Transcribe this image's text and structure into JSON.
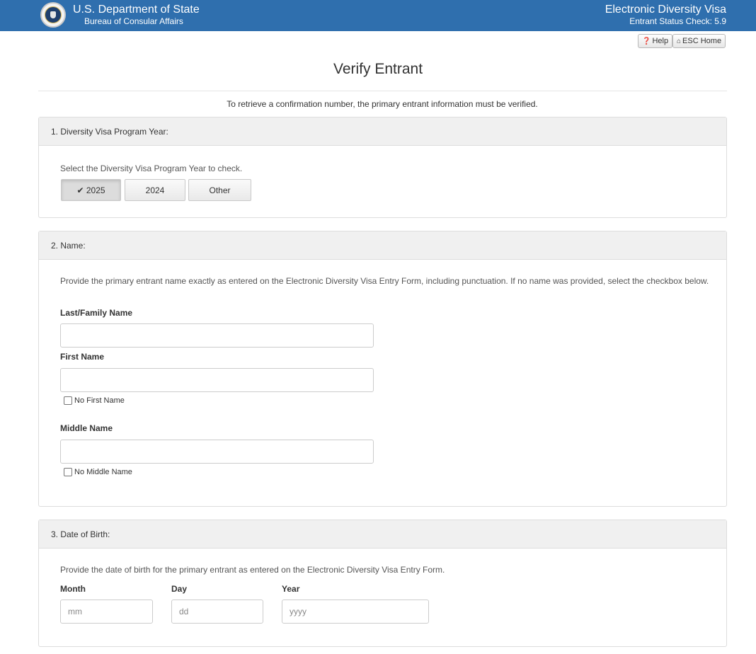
{
  "header": {
    "agency_title": "U.S. Department of State",
    "agency_subtitle": "Bureau of Consular Affairs",
    "app_title": "Electronic Diversity Visa",
    "app_subtitle": "Entrant Status Check: 5.9",
    "background_color": "#2f6fae"
  },
  "toolbar": {
    "help_label": "Help",
    "help_icon": "question-circle-icon",
    "home_label": "ESC Home",
    "home_icon": "home-icon"
  },
  "page": {
    "title": "Verify Entrant",
    "intro": "To retrieve a confirmation number, the primary entrant information must be verified."
  },
  "section_year": {
    "heading": "1. Diversity Visa Program Year:",
    "help": "Select the Diversity Visa Program Year to check.",
    "options": [
      {
        "label": "2025",
        "selected": true
      },
      {
        "label": "2024",
        "selected": false
      },
      {
        "label": "Other",
        "selected": false
      }
    ],
    "check_glyph": "✔"
  },
  "section_name": {
    "heading": "2. Name:",
    "help": "Provide the primary entrant name exactly as entered on the Electronic Diversity Visa Entry Form, including punctuation. If no name was provided, select the checkbox below.",
    "last_label": "Last/Family Name",
    "last_value": "",
    "first_label": "First Name",
    "first_value": "",
    "no_first_label": "No First Name",
    "middle_label": "Middle Name",
    "middle_value": "",
    "no_middle_label": "No Middle Name"
  },
  "section_dob": {
    "heading": "3. Date of Birth:",
    "help": "Provide the date of birth for the primary entrant as entered on the Electronic Diversity Visa Entry Form.",
    "month_label": "Month",
    "month_placeholder": "mm",
    "day_label": "Day",
    "day_placeholder": "dd",
    "year_label": "Year",
    "year_placeholder": "yyyy"
  }
}
